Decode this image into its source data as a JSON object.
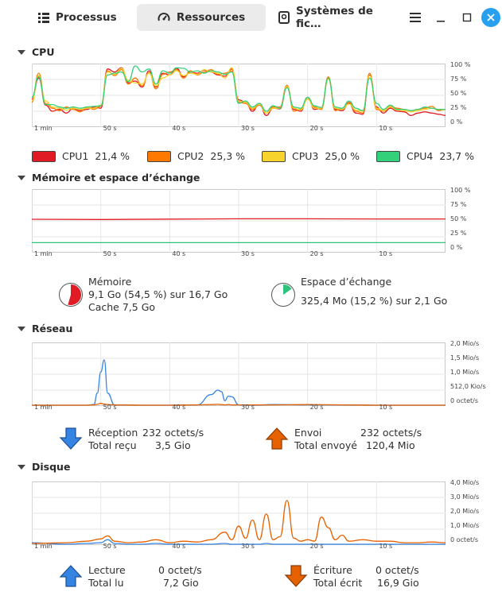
{
  "tabs": [
    {
      "label": "Processus",
      "icon": "list-icon",
      "active": false
    },
    {
      "label": "Ressources",
      "icon": "gauge-icon",
      "active": true
    },
    {
      "label": "Systèmes de fic…",
      "icon": "disk-icon",
      "active": false
    }
  ],
  "colors": {
    "cpu1": "#e01b24",
    "cpu2": "#ff7800",
    "cpu3": "#f6d32d",
    "cpu4": "#33d17a",
    "memory": "#e01b24",
    "swap": "#2ec27e",
    "receive": "#3584e4",
    "send": "#e66100",
    "accent": "#28a0f0"
  },
  "x_ticks": [
    "1 min",
    "50 s",
    "40 s",
    "30 s",
    "20 s",
    "10 s"
  ],
  "cpu": {
    "title": "CPU",
    "y_ticks": [
      "100 %",
      "75 %",
      "50 %",
      "25 %",
      "0 %"
    ],
    "legend": [
      {
        "name": "CPU1",
        "value": "21,4 %"
      },
      {
        "name": "CPU2",
        "value": "25,3 %"
      },
      {
        "name": "CPU3",
        "value": "25,0 %"
      },
      {
        "name": "CPU4",
        "value": "23,7 %"
      }
    ],
    "chart_data": {
      "type": "line",
      "x": [
        60,
        59,
        58,
        57,
        56,
        55,
        54,
        53,
        52,
        51,
        50,
        49,
        48,
        47,
        46,
        45,
        44,
        43,
        42,
        41,
        40,
        39,
        38,
        37,
        36,
        35,
        34,
        33,
        32,
        31,
        30,
        29,
        28,
        27,
        26,
        25,
        24,
        23,
        22,
        21,
        20,
        19,
        18,
        17,
        16,
        15,
        14,
        13,
        12,
        11,
        10,
        9,
        8,
        7,
        6,
        5,
        4,
        3,
        2,
        1,
        0
      ],
      "series": [
        {
          "name": "CPU1",
          "values": [
            45,
            80,
            35,
            25,
            28,
            22,
            30,
            26,
            28,
            32,
            30,
            95,
            90,
            97,
            72,
            75,
            65,
            92,
            65,
            88,
            85,
            96,
            82,
            90,
            88,
            93,
            90,
            85,
            83,
            95,
            44,
            40,
            25,
            38,
            18,
            30,
            29,
            65,
            28,
            25,
            48,
            28,
            30,
            80,
            28,
            26,
            38,
            22,
            20,
            85,
            32,
            22,
            30,
            25,
            24,
            18,
            22,
            24,
            22,
            20,
            18
          ]
        },
        {
          "name": "CPU2",
          "values": [
            40,
            88,
            38,
            30,
            26,
            32,
            28,
            24,
            32,
            28,
            33,
            92,
            84,
            94,
            70,
            80,
            67,
            89,
            62,
            86,
            90,
            94,
            80,
            92,
            85,
            90,
            94,
            86,
            88,
            92,
            40,
            38,
            28,
            35,
            22,
            32,
            32,
            68,
            25,
            28,
            45,
            32,
            28,
            82,
            26,
            30,
            40,
            25,
            22,
            88,
            28,
            25,
            33,
            30,
            28,
            26,
            28,
            30,
            33,
            26,
            28
          ]
        },
        {
          "name": "CPU3",
          "values": [
            42,
            84,
            42,
            32,
            30,
            27,
            30,
            28,
            30,
            30,
            35,
            90,
            86,
            96,
            76,
            72,
            70,
            88,
            67,
            80,
            85,
            92,
            84,
            88,
            86,
            94,
            90,
            88,
            80,
            97,
            42,
            40,
            30,
            37,
            22,
            30,
            30,
            66,
            30,
            27,
            45,
            30,
            30,
            78,
            30,
            28,
            37,
            27,
            25,
            84,
            30,
            26,
            32,
            27,
            26,
            24,
            26,
            28,
            30,
            28,
            27
          ]
        },
        {
          "name": "CPU4",
          "values": [
            48,
            82,
            36,
            36,
            32,
            30,
            32,
            30,
            32,
            33,
            34,
            85,
            88,
            90,
            74,
            100,
            90,
            95,
            70,
            92,
            88,
            97,
            96,
            90,
            92,
            88,
            92,
            90,
            86,
            90,
            38,
            42,
            32,
            38,
            25,
            34,
            30,
            64,
            32,
            30,
            48,
            34,
            31,
            80,
            32,
            30,
            42,
            30,
            26,
            80,
            38,
            28,
            35,
            28,
            28,
            26,
            28,
            32,
            30,
            28,
            28
          ]
        }
      ],
      "ylim": [
        0,
        100
      ],
      "grid": true
    }
  },
  "memory": {
    "title": "Mémoire et espace d’échange",
    "y_ticks": [
      "100 %",
      "75 %",
      "50 %",
      "25 %",
      "0 %"
    ],
    "chart_data": {
      "type": "line",
      "x": [
        60,
        50,
        40,
        30,
        20,
        10,
        0
      ],
      "series": [
        {
          "name": "Mémoire",
          "values": [
            54.0,
            53.5,
            54.2,
            54.8,
            54.8,
            54.5,
            54.5
          ]
        },
        {
          "name": "Espace d’échange",
          "values": [
            15.2,
            15.2,
            15.2,
            15.2,
            15.2,
            15.2,
            15.2
          ]
        }
      ],
      "ylim": [
        0,
        100
      ],
      "grid": true
    },
    "mem_label": "Mémoire",
    "mem_line1": "9,1 Go (54,5 %) sur 16,7 Go",
    "mem_line2": "Cache 7,5 Go",
    "mem_fraction": 0.545,
    "swap_label": "Espace d’échange",
    "swap_line1": "325,4 Mo (15,2 %) sur 2,1 Go",
    "swap_fraction": 0.152
  },
  "network": {
    "title": "Réseau",
    "y_ticks": [
      "2,0 Mio/s",
      "1,5 Mio/s",
      "1,0 Mio/s",
      "512,0 Kio/s",
      "0 octet/s"
    ],
    "chart_data": {
      "type": "line",
      "x": [
        60,
        52,
        51,
        50.5,
        50,
        49.5,
        49,
        48,
        44,
        40,
        36,
        34,
        33,
        32.5,
        32,
        31.5,
        31,
        30,
        28,
        25,
        20,
        15,
        10,
        5,
        0
      ],
      "series": [
        {
          "name": "Réception",
          "values": [
            0,
            0,
            0.02,
            0.4,
            1.1,
            1.5,
            0.4,
            0.01,
            0,
            0,
            0.01,
            0.35,
            0.5,
            0.45,
            0.15,
            0.3,
            0.28,
            0.01,
            0.0,
            0.02,
            0.01,
            0.01,
            0.0,
            0.0,
            0.0
          ]
        },
        {
          "name": "Envoi",
          "values": [
            0,
            0,
            0.01,
            0.03,
            0.06,
            0.04,
            0.02,
            0.01,
            0,
            0,
            0.01,
            0.02,
            0.03,
            0.02,
            0.01,
            0.02,
            0.01,
            0.01,
            0.01,
            0.01,
            0.02,
            0.01,
            0.0,
            0.0,
            0.0
          ]
        }
      ],
      "ylim": [
        0,
        2.0
      ],
      "grid": true
    },
    "recv_label": "Réception",
    "recv_value": "232 octets/s",
    "recv_total_label": "Total reçu",
    "recv_total": "3,5 Gio",
    "send_label": "Envoi",
    "send_value": "232 octets/s",
    "send_total_label": "Total envoyé",
    "send_total": "120,4 Mio"
  },
  "disk": {
    "title": "Disque",
    "y_ticks": [
      "4,0 Mio/s",
      "3,0 Mio/s",
      "2,0 Mio/s",
      "1,0 Mio/s",
      "0 octet/s"
    ],
    "chart_data": {
      "type": "line",
      "x": [
        60,
        55,
        52,
        50,
        49,
        48,
        46,
        44,
        42,
        40,
        38,
        36,
        34,
        32,
        31,
        30,
        29,
        28,
        27,
        26,
        25,
        24,
        23,
        22,
        21,
        20,
        19,
        18,
        17,
        16,
        15,
        14,
        12,
        10,
        8,
        6,
        4,
        2,
        0
      ],
      "series": [
        {
          "name": "Lecture",
          "values": [
            0.1,
            0.0,
            0.05,
            0.1,
            0.3,
            0.05,
            0.0,
            0.0,
            0.05,
            0.0,
            0.0,
            0.0,
            0.0,
            0.05,
            0.0,
            0.0,
            0.0,
            0.0,
            0.0,
            0.05,
            0.0,
            0.0,
            0.0,
            0.0,
            0.0,
            0.0,
            0.0,
            0.0,
            0.0,
            0.0,
            0.0,
            0.0,
            0.0,
            0.0,
            0.0,
            0.0,
            0.0,
            0.0,
            0.0
          ]
        },
        {
          "name": "Écriture",
          "values": [
            0.05,
            0.1,
            0.2,
            0.35,
            0.55,
            0.2,
            0.1,
            0.15,
            0.3,
            0.1,
            0.2,
            0.15,
            0.3,
            0.8,
            0.3,
            1.2,
            0.4,
            1.6,
            0.3,
            2.0,
            0.3,
            0.5,
            2.9,
            0.4,
            0.2,
            0.3,
            0.2,
            1.8,
            1.1,
            0.3,
            0.6,
            0.2,
            0.3,
            0.2,
            0.2,
            0.1,
            0.1,
            0.15,
            0.1
          ]
        }
      ],
      "ylim": [
        0,
        4.0
      ],
      "grid": true
    },
    "read_label": "Lecture",
    "read_value": "0 octet/s",
    "read_total_label": "Total lu",
    "read_total": "7,2 Gio",
    "write_label": "Écriture",
    "write_value": "0 octet/s",
    "write_total_label": "Total écrit",
    "write_total": "16,9 Gio"
  }
}
